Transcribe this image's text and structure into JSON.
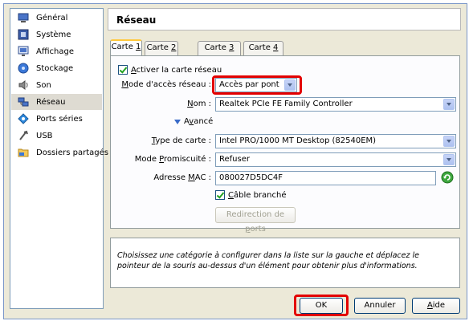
{
  "sidebar": {
    "items": [
      {
        "label": "Général",
        "icon": "general-icon"
      },
      {
        "label": "Système",
        "icon": "system-icon"
      },
      {
        "label": "Affichage",
        "icon": "display-icon"
      },
      {
        "label": "Stockage",
        "icon": "storage-icon"
      },
      {
        "label": "Son",
        "icon": "sound-icon"
      },
      {
        "label": "Réseau",
        "icon": "network-icon",
        "selected": true
      },
      {
        "label": "Ports séries",
        "icon": "serial-ports-icon"
      },
      {
        "label": "USB",
        "icon": "usb-icon"
      },
      {
        "label": "Dossiers partagés",
        "icon": "shared-folders-icon"
      }
    ]
  },
  "heading": "Réseau",
  "tabs": [
    {
      "pre": "Carte ",
      "key": "1",
      "post": ""
    },
    {
      "pre": "Carte ",
      "key": "2",
      "post": ""
    },
    {
      "pre": "Carte ",
      "key": "3",
      "post": ""
    },
    {
      "pre": "Carte ",
      "key": "4",
      "post": ""
    }
  ],
  "network": {
    "enable": {
      "pre": "",
      "key": "A",
      "post": "ctiver la carte réseau"
    },
    "mode": {
      "pre": "",
      "key": "M",
      "post": "ode d'accès réseau :",
      "value": "Accès par pont"
    },
    "name": {
      "pre": "",
      "key": "N",
      "post": "om :",
      "value": "Realtek PCIe FE Family Controller"
    },
    "advanced": {
      "pre": "A",
      "key": "v",
      "post": "ancé"
    },
    "adapter": {
      "pre": "",
      "key": "T",
      "post": "ype de carte :",
      "value": "Intel PRO/1000 MT Desktop (82540EM)"
    },
    "promisc": {
      "pre": "Mode ",
      "key": "P",
      "post": "romiscuité :",
      "value": "Refuser"
    },
    "mac": {
      "pre": "Adresse ",
      "key": "M",
      "post": "AC :",
      "value": "080027D5DC4F"
    },
    "cable": {
      "pre": "",
      "key": "C",
      "post": "âble branché"
    },
    "port_fwd": {
      "pre": "Redirection de ",
      "key": "p",
      "post": "orts"
    }
  },
  "info_text": "Choisissez une catégorie à configurer dans la liste sur la gauche et déplacez le pointeur de la souris au-dessus d'un élément pour obtenir plus d'informations.",
  "buttons": {
    "ok": "OK",
    "cancel": "Annuler",
    "help": {
      "pre": "",
      "key": "A",
      "post": "ide"
    }
  },
  "colors": {
    "highlight": "#e30000",
    "selected_bg": "#dedbd2",
    "tab_accent": "#ffc83c"
  }
}
